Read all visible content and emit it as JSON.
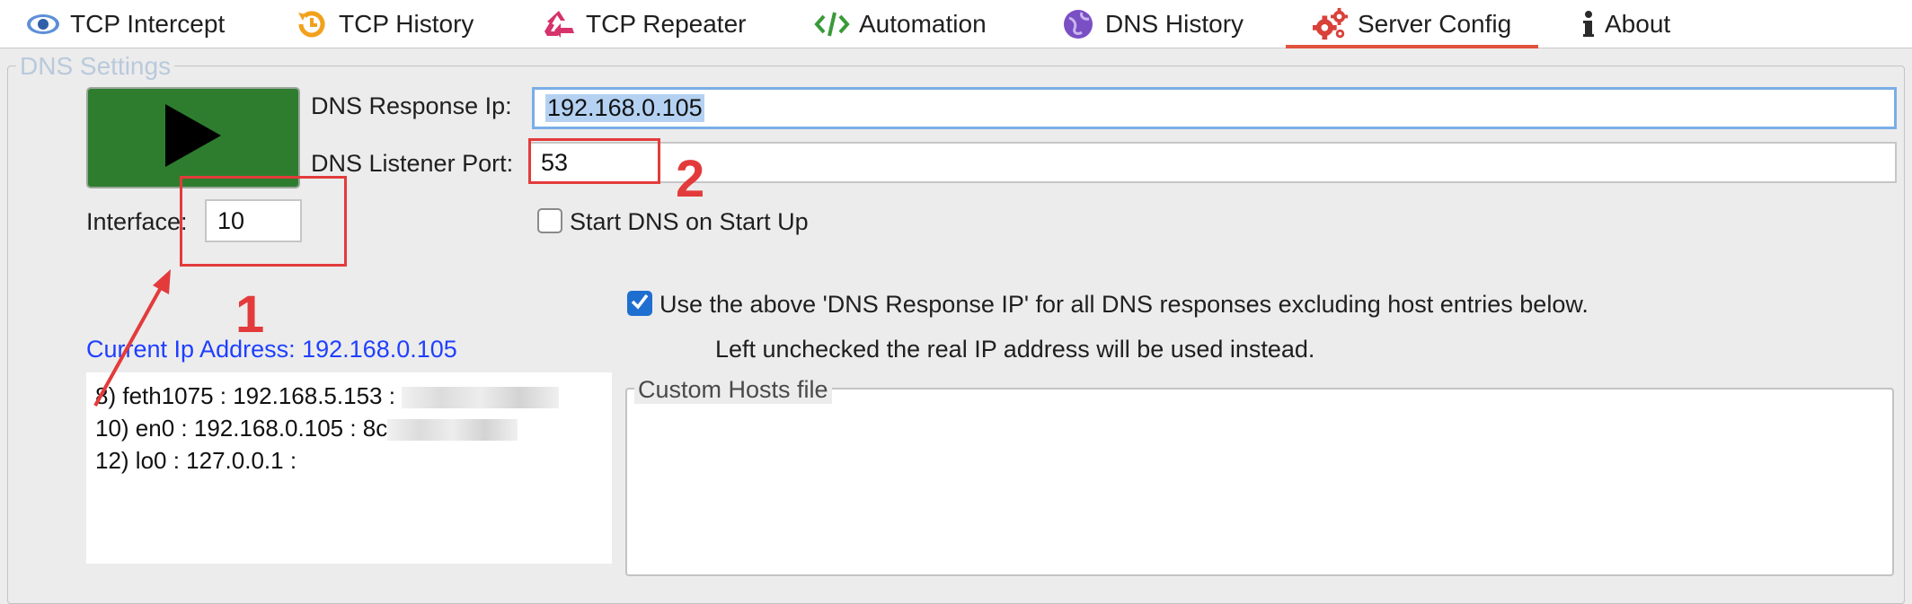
{
  "tabs": [
    {
      "label": "TCP Intercept",
      "icon": "eye-icon"
    },
    {
      "label": "TCP History",
      "icon": "history-clock-icon"
    },
    {
      "label": "TCP Repeater",
      "icon": "recycle-icon"
    },
    {
      "label": "Automation",
      "icon": "code-icon"
    },
    {
      "label": "DNS History",
      "icon": "globe-icon"
    },
    {
      "label": "Server Config",
      "icon": "gears-icon",
      "active": true
    },
    {
      "label": "About",
      "icon": "info-icon"
    }
  ],
  "dns_settings": {
    "title": "DNS Settings",
    "response_ip_label": "DNS Response Ip:",
    "response_ip_value": "192.168.0.105",
    "listener_port_label": "DNS Listener Port:",
    "listener_port_value": "53",
    "interface_label": "Interface:",
    "interface_value": "10",
    "start_on_startup_label": "Start DNS on Start Up",
    "start_on_startup_checked": false,
    "use_response_ip_label": "Use the above 'DNS Response IP' for all DNS responses excluding host entries below.",
    "use_response_ip_checked": true,
    "use_response_ip_note": "Left unchecked the real IP address will be used instead.",
    "current_ip_label": "Current Ip Address: 192.168.0.105",
    "interfaces": [
      "8) feth1075 : 192.168.5.153 : ",
      "10) en0 : 192.168.0.105 : 8c",
      "12) lo0 : 127.0.0.1 :"
    ],
    "custom_hosts_title": "Custom Hosts file"
  },
  "annotations": {
    "marker_1": "1",
    "marker_2": "2"
  },
  "colors": {
    "accent_tab": "#e0533c",
    "play_button": "#2e7d2f",
    "link_blue": "#1f3fff",
    "annotation_red": "#e33b3b",
    "checkbox_blue": "#1f6fd1"
  }
}
